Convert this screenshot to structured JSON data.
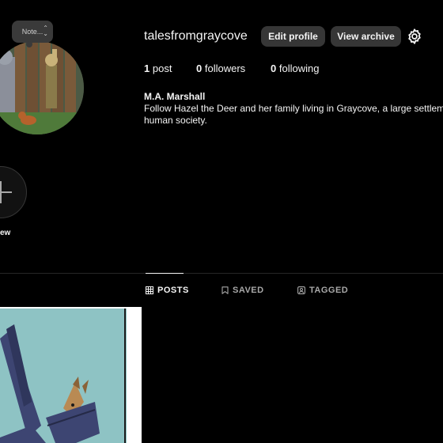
{
  "note": {
    "label": "Note..."
  },
  "profile": {
    "username": "talesfromgraycove",
    "full_name": "M.A. Marshall",
    "bio_line1": "Follow Hazel the Deer and her family living in Graycove, a large settlement f",
    "bio_line2": "human society."
  },
  "actions": {
    "edit_profile": "Edit profile",
    "view_archive": "View archive",
    "settings_icon": "gear-icon"
  },
  "stats": {
    "posts_count": "1",
    "posts_label": "post",
    "followers_count": "0",
    "followers_label": "followers",
    "following_count": "0",
    "following_label": "following"
  },
  "highlights": {
    "new_label": "ew"
  },
  "tabs": [
    {
      "label": "POSTS",
      "icon": "grid-icon",
      "active": true
    },
    {
      "label": "SAVED",
      "icon": "bookmark-icon",
      "active": false
    },
    {
      "label": "TAGGED",
      "icon": "tag-icon",
      "active": false
    }
  ],
  "colors": {
    "background": "#000000",
    "button": "#363636",
    "text": "#f5f5f5",
    "muted": "#a8a8a8",
    "divider": "#262626"
  }
}
